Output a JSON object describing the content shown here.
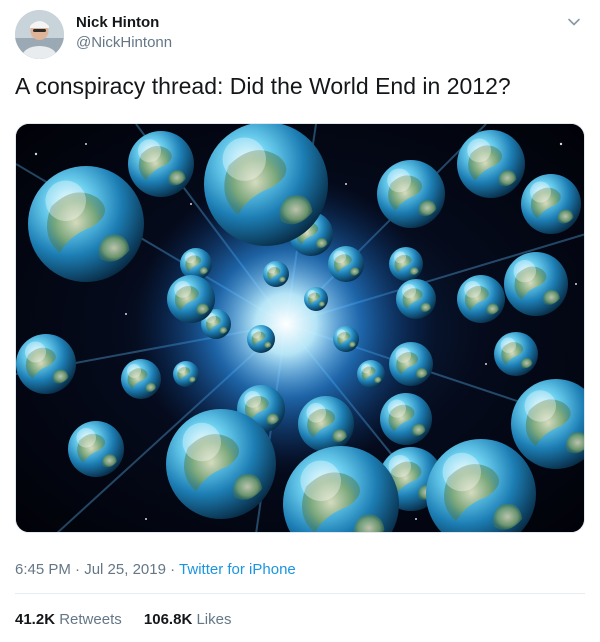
{
  "author": {
    "name": "Nick Hinton",
    "handle": "@NickHintonn"
  },
  "tweet": {
    "text": "A conspiracy thread: Did the World End in 2012?"
  },
  "media": {
    "alt": "Many copies of Earth exploding outward from a bright blue burst of light"
  },
  "meta": {
    "time": "6:45 PM",
    "separator": "·",
    "date": "Jul 25, 2019",
    "source": "Twitter for iPhone"
  },
  "stats": {
    "retweets_count": "41.2K",
    "retweets_label": "Retweets",
    "likes_count": "106.8K",
    "likes_label": "Likes"
  },
  "icons": {
    "caret": "chevron-down-icon"
  },
  "colors": {
    "link": "#1b95e0",
    "secondary_text": "#657786",
    "primary_text": "#14171a"
  }
}
